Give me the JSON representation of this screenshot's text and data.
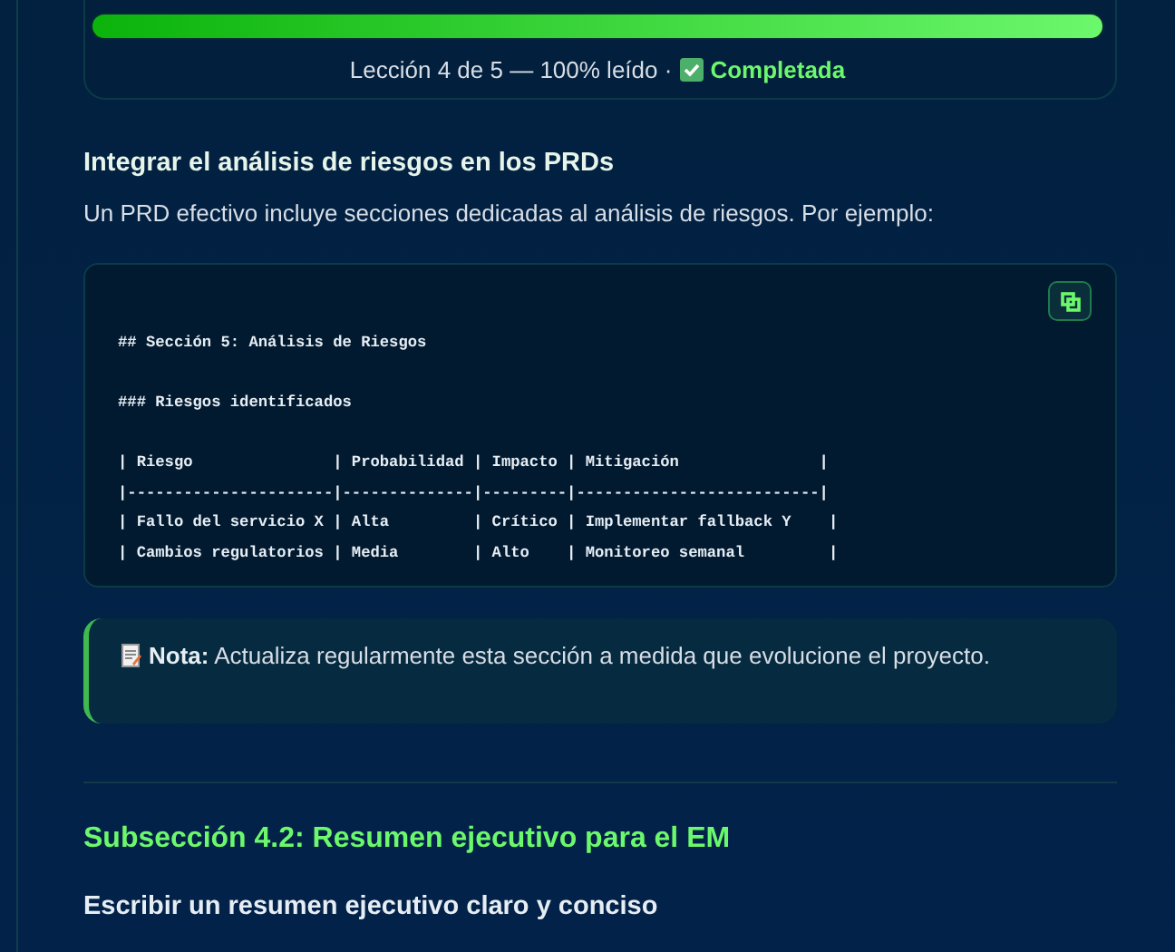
{
  "progress": {
    "level": 1,
    "label": "Lección 4 de 5 — 100% leído ·",
    "completed": true,
    "status": "Completada"
  },
  "heading": "Integrar el análisis de riesgos en los PRDs",
  "paragraph": "Un PRD efectivo incluye secciones dedicadas al análisis de riesgos. Por ejemplo:",
  "code_block": {
    "paragraphs": [
      [
        "## Sección 5: Análisis de Riesgos"
      ],
      [
        "### Riesgos identificados"
      ],
      [
        "| Riesgo               | Probabilidad | Impacto | Mitigación               |",
        "|----------------------|--------------|---------|--------------------------|",
        "| Fallo del servicio X | Alta         | Crítico | Implementar fallback Y    |",
        "| Cambios regulatorios | Media        | Alto    | Monitoreo semanal         |"
      ]
    ]
  },
  "note": {
    "label": "Nota:",
    "text": "Actualiza regularmente esta sección a medida que evolucione el proyecto."
  },
  "subsection_title": "Subsección 4.2: Resumen ejecutivo para el EM",
  "subheading": "Escribir un resumen ejecutivo claro y conciso"
}
